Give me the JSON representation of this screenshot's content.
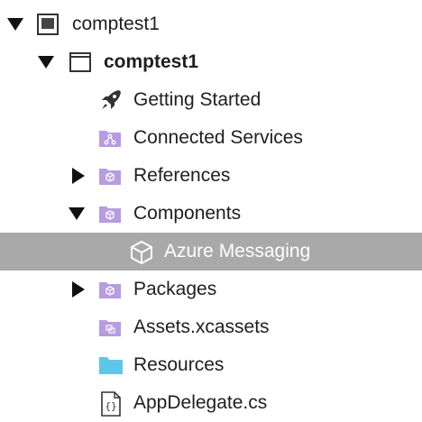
{
  "solution": {
    "label": "comptest1",
    "expanded": true,
    "icon": "solution-icon"
  },
  "project": {
    "label": "comptest1",
    "expanded": true,
    "icon": "project-icon"
  },
  "items": [
    {
      "label": "Getting Started",
      "icon": "rocket-icon"
    },
    {
      "label": "Connected Services",
      "icon": "connected-services-folder-icon"
    },
    {
      "label": "References",
      "icon": "references-folder-icon",
      "expandable": true,
      "expanded": false
    },
    {
      "label": "Components",
      "icon": "components-folder-icon",
      "expandable": true,
      "expanded": true
    },
    {
      "label": "Azure Messaging",
      "icon": "cube-icon",
      "selected": true
    },
    {
      "label": "Packages",
      "icon": "packages-folder-icon",
      "expandable": true,
      "expanded": false
    },
    {
      "label": "Assets.xcassets",
      "icon": "assets-folder-icon"
    },
    {
      "label": "Resources",
      "icon": "folder-icon"
    },
    {
      "label": "AppDelegate.cs",
      "icon": "csharp-file-icon"
    }
  ],
  "colors": {
    "selection": "#a9a9a9",
    "purple_folder": "#b79ce0",
    "blue_folder": "#5fc6e8",
    "text": "#1e1e1e"
  }
}
